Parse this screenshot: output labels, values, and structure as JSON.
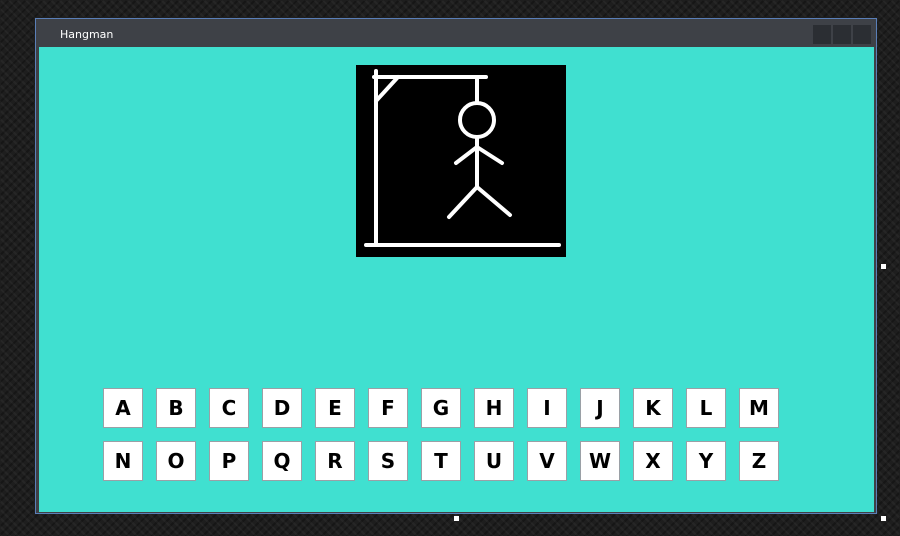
{
  "window": {
    "title": "Hangman"
  },
  "colors": {
    "client_background": "#40e0d0",
    "titlebar": "#3e4147",
    "gallows_background": "#000000",
    "gallows_stroke": "#ffffff",
    "window_border": "#5a7fb8"
  },
  "letters": {
    "row1": [
      "A",
      "B",
      "C",
      "D",
      "E",
      "F",
      "G",
      "H",
      "I",
      "J",
      "K",
      "L",
      "M"
    ],
    "row2": [
      "N",
      "O",
      "P",
      "Q",
      "R",
      "S",
      "T",
      "U",
      "V",
      "W",
      "X",
      "Y",
      "Z"
    ]
  }
}
